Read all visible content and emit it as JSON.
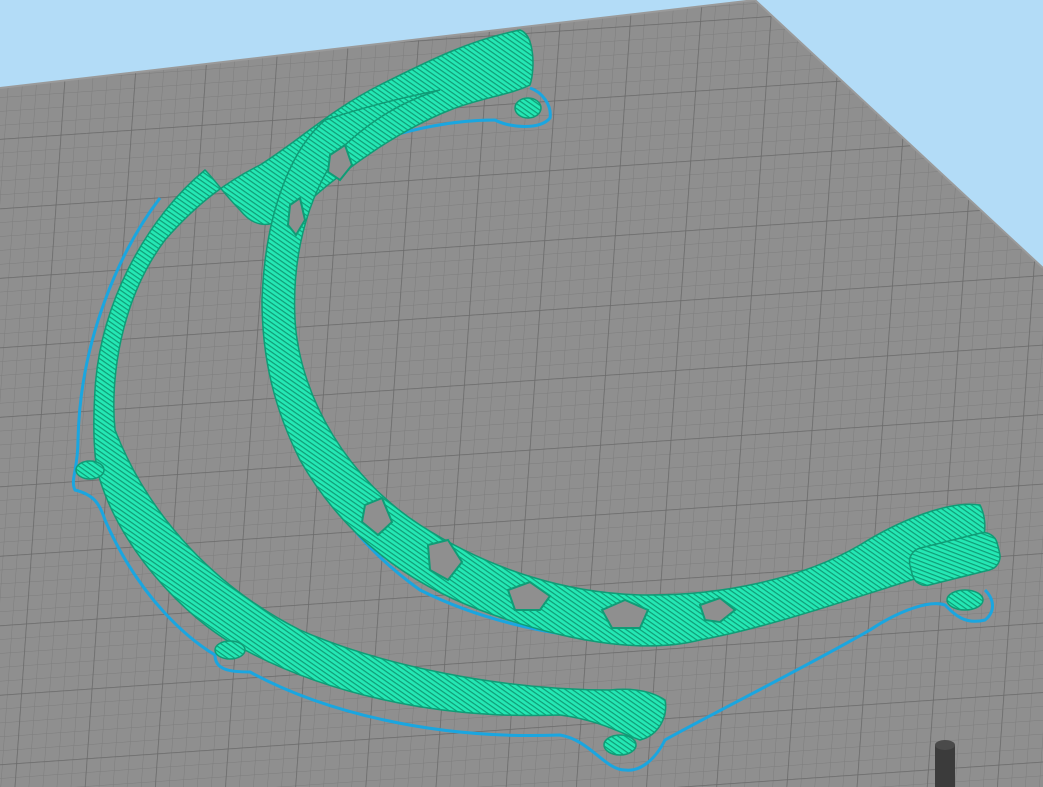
{
  "app": {
    "view": "slicer-preview-3d",
    "background_color": "#b3dcf7",
    "bed_color": "#8f8f8f",
    "grid_minor_color": "#7d7d7d",
    "grid_major_color": "#6a6a6a"
  },
  "model": {
    "object": "face-shield-headband",
    "layer_color": "#1ee6b0",
    "layer_shade_color": "#0f9c76",
    "skirt_color": "#1aa6e0",
    "visible_parts": [
      "outer-band",
      "inner-band",
      "visor-pegs",
      "skirt-outline"
    ]
  },
  "tool": {
    "icon": "nozzle-icon",
    "color": "#3b3b3b"
  }
}
